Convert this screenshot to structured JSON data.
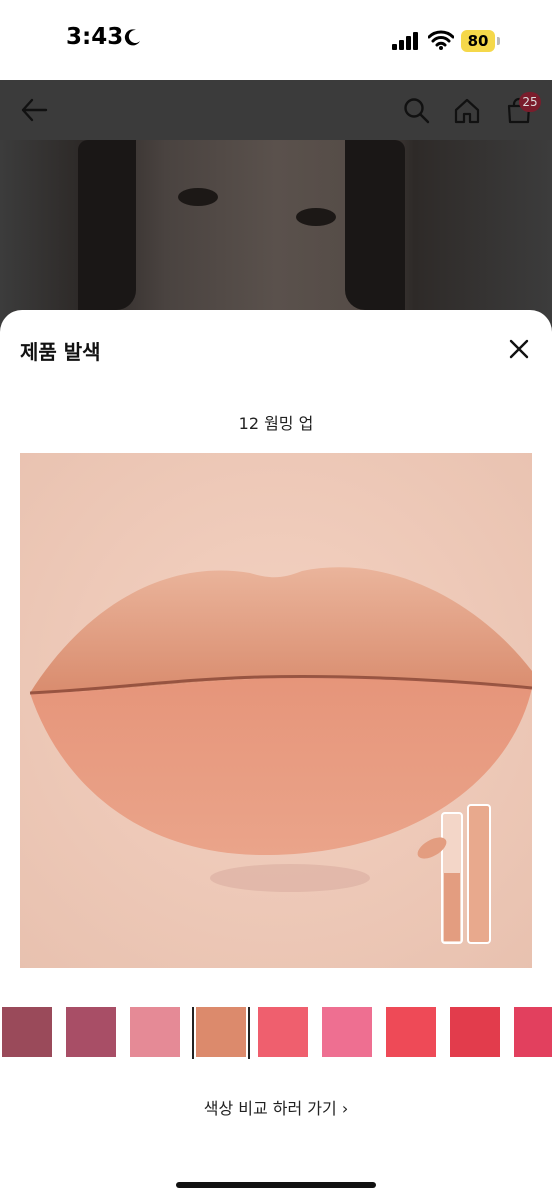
{
  "status_bar": {
    "time": "3:43",
    "battery": "80"
  },
  "header": {
    "cart_count": "25"
  },
  "sheet": {
    "title": "제품 발색",
    "shade_name": "12 웜밍 업",
    "compare_link": "색상 비교 하러 가기 ›"
  },
  "swatches": [
    {
      "color": "#9a4a5a",
      "selected": false
    },
    {
      "color": "#a84e66",
      "selected": false
    },
    {
      "color": "#e58a96",
      "selected": false
    },
    {
      "color": "#dc8a6c",
      "selected": true
    },
    {
      "color": "#ef5f6e",
      "selected": false
    },
    {
      "color": "#ee6f91",
      "selected": false
    },
    {
      "color": "#ee4a57",
      "selected": false
    },
    {
      "color": "#e23c4c",
      "selected": false
    },
    {
      "color": "#e2405e",
      "selected": false
    }
  ],
  "icons": [
    "back-arrow-icon",
    "search-icon",
    "home-icon",
    "shopping-bag-icon",
    "close-icon",
    "moon-icon",
    "signal-icon",
    "wifi-icon"
  ]
}
